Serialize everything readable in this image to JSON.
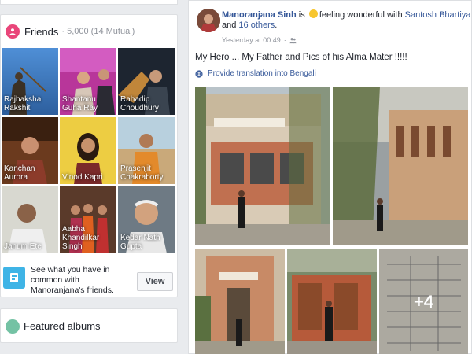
{
  "friends": {
    "title": "Friends",
    "count_text": "· 5,000 (14 Mutual)",
    "tiles": [
      {
        "name": "Rajbaksha Rakshit"
      },
      {
        "name": "Shantanu Guha Ray"
      },
      {
        "name": "Rahadip Choudhury"
      },
      {
        "name": "Kanchan Aurora"
      },
      {
        "name": "Vinod Kapri"
      },
      {
        "name": "Prasenjit Chakraborty"
      },
      {
        "name": "Janum Ete"
      },
      {
        "name": "Aabha Khandilkar Singh"
      },
      {
        "name": "Kedar Nath Gupta"
      }
    ],
    "common_text": "See what you have in common with Manoranjana's friends.",
    "view_label": "View"
  },
  "albums": {
    "title": "Featured albums"
  },
  "post": {
    "author": "Manoranjana Sinh",
    "is_text": " is ",
    "feeling_text": "feeling wonderful with ",
    "tagged_friend": "Santosh Bhartiya",
    "and_text": " and ",
    "others": "16 others",
    "period": ".",
    "timestamp": "Yesterday at 00:49",
    "separator": "·",
    "text": "My Hero ... My Father and Pics of his Alma Mater !!!!!",
    "translation_link": "Provide translation into Bengali",
    "more_photos": "+4"
  },
  "colors": {
    "link": "#365899",
    "background": "#e9ebee",
    "friends_icon": "#e9467a",
    "common_icon": "#3fb4e6",
    "albums_icon": "#74c2a4"
  },
  "icons": [
    "friends-icon",
    "common-friends-icon",
    "albums-icon",
    "feeling-emoji-icon",
    "audience-friends-icon",
    "globe-icon"
  ]
}
